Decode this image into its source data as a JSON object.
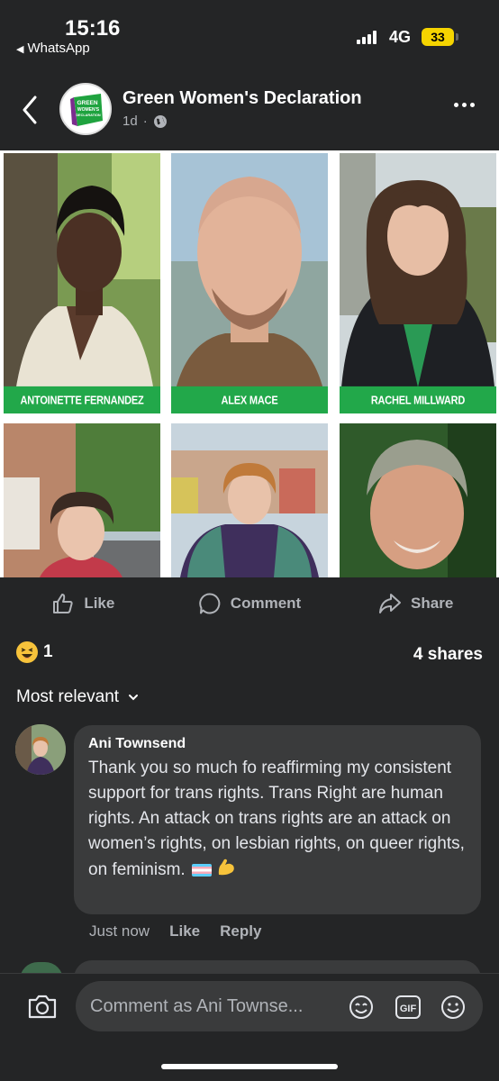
{
  "status_bar": {
    "time": "15:16",
    "back_app": "WhatsApp",
    "network": "4G",
    "battery": "33"
  },
  "header": {
    "page_name": "Green Women's Declaration",
    "post_age": "1d",
    "separator": "·"
  },
  "logo": {
    "line1": "GREEN",
    "line2": "WOMEN'S",
    "line3": "DECLARATION",
    "color": "#1fa33f",
    "accent": "#7b2d8e"
  },
  "candidates": [
    {
      "name": "ANTOINETTE FERNANDEZ"
    },
    {
      "name": "ALEX MACE"
    },
    {
      "name": "RACHEL MILLWARD"
    }
  ],
  "actions": {
    "like": "Like",
    "comment": "Comment",
    "share": "Share"
  },
  "reactions": {
    "count": "1",
    "shares": "4 shares"
  },
  "sort": {
    "label": "Most relevant"
  },
  "comment": {
    "author": "Ani Townsend",
    "text": "Thank you so much fo reaffirming my consistent support for trans rights. Trans Right are human rights. An attack on trans rights are an attack on women’s rights, on lesbian rights, on queer rights, on feminism.",
    "time": "Just now",
    "like": "Like",
    "reply": "Reply"
  },
  "composer": {
    "placeholder": "Comment as Ani Townse..."
  },
  "colors": {
    "background": "#242526",
    "bubble": "#3a3b3c",
    "name_bar": "#22a84a",
    "muted_text": "#b0b3b8"
  }
}
